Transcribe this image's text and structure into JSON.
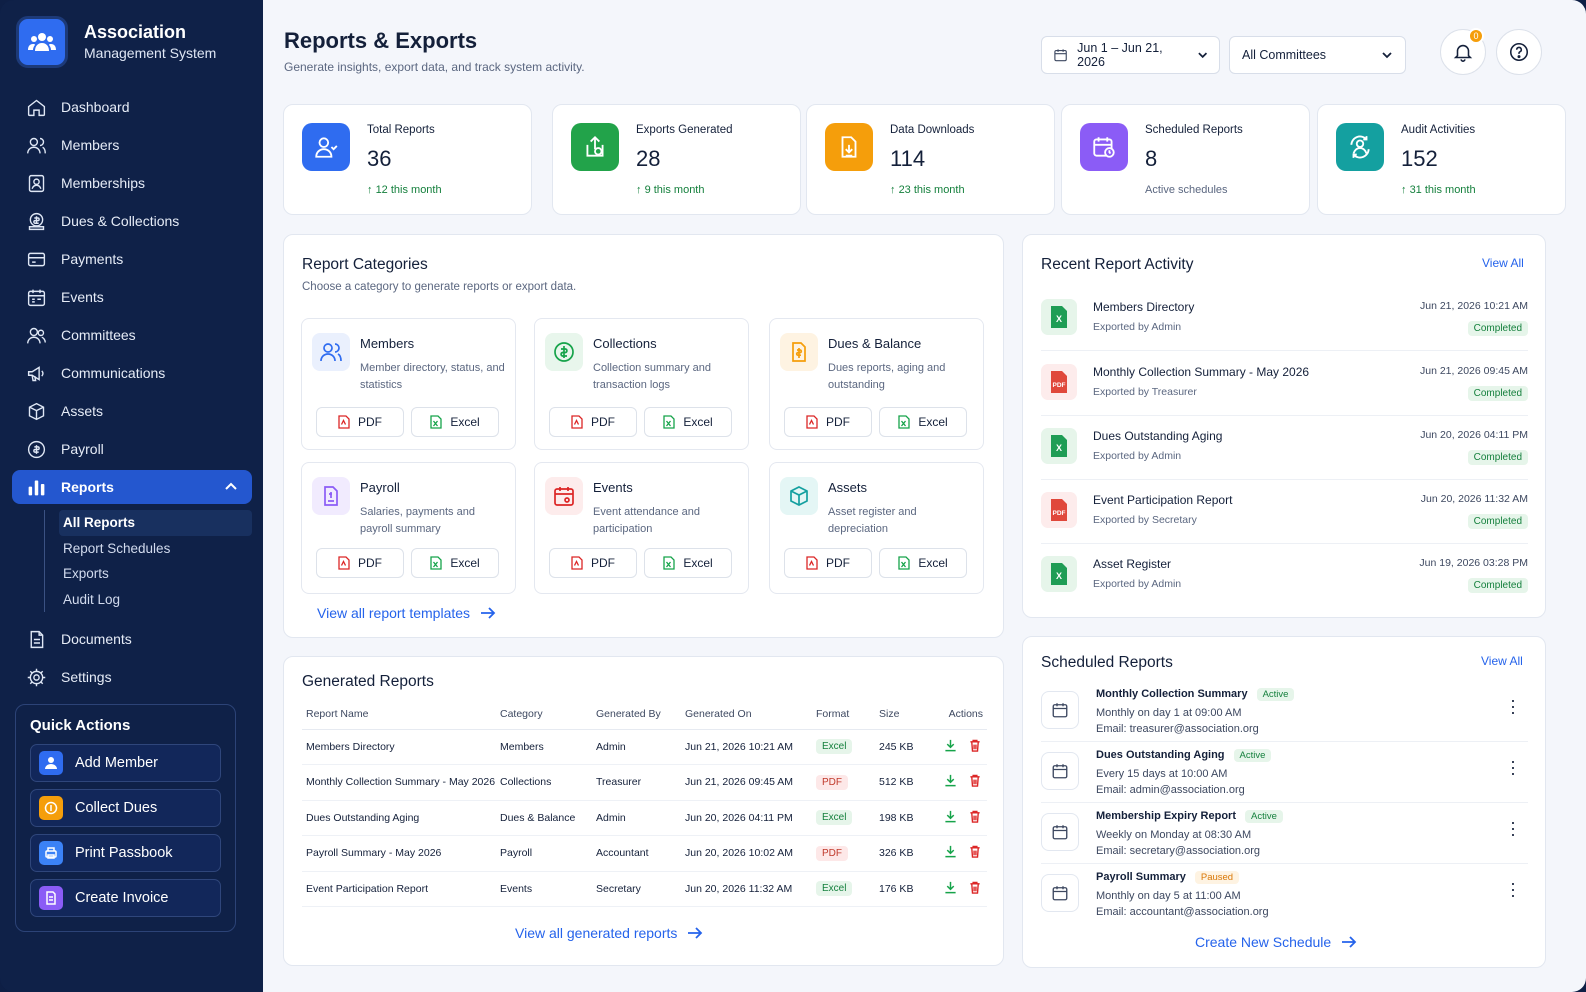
{
  "brand": {
    "title": "Association",
    "subtitle": "Management System"
  },
  "sidebar": {
    "items": [
      {
        "label": "Dashboard",
        "icon": "home-icon"
      },
      {
        "label": "Members",
        "icon": "users-icon"
      },
      {
        "label": "Memberships",
        "icon": "id-card-icon"
      },
      {
        "label": "Dues & Collections",
        "icon": "coins-icon"
      },
      {
        "label": "Payments",
        "icon": "credit-card-icon"
      },
      {
        "label": "Events",
        "icon": "calendar-icon"
      },
      {
        "label": "Committees",
        "icon": "group-icon"
      },
      {
        "label": "Communications",
        "icon": "megaphone-icon"
      },
      {
        "label": "Assets",
        "icon": "box-icon"
      },
      {
        "label": "Payroll",
        "icon": "payroll-icon"
      },
      {
        "label": "Reports",
        "icon": "bar-chart-icon"
      },
      {
        "label": "Documents",
        "icon": "document-icon"
      },
      {
        "label": "Settings",
        "icon": "gear-icon"
      }
    ],
    "reports_sub": [
      "All Reports",
      "Report Schedules",
      "Exports",
      "Audit Log"
    ],
    "active_sub": "All Reports"
  },
  "quick_actions": {
    "title": "Quick Actions",
    "items": [
      {
        "label": "Add Member",
        "icon": "user-add-icon",
        "color": "#2f6cf0"
      },
      {
        "label": "Collect Dues",
        "icon": "coin-icon",
        "color": "#f59e0b"
      },
      {
        "label": "Print Passbook",
        "icon": "print-icon",
        "color": "#3b82f6"
      },
      {
        "label": "Create Invoice",
        "icon": "invoice-icon",
        "color": "#8b5cf6"
      }
    ]
  },
  "header": {
    "title": "Reports & Exports",
    "subtitle": "Generate insights, export data, and track system activity.",
    "date_range": "Jun 1 – Jun 21, 2026",
    "committee_filter": "All Committees",
    "notification_count": "0"
  },
  "stats": [
    {
      "label": "Total Reports",
      "value": "36",
      "delta": "12 this month",
      "color": "#2f6cf0"
    },
    {
      "label": "Exports Generated",
      "value": "28",
      "delta": "9 this month",
      "color": "#22a34a"
    },
    {
      "label": "Data Downloads",
      "value": "114",
      "delta": "23 this month",
      "color": "#f59e0b"
    },
    {
      "label": "Scheduled Reports",
      "value": "8",
      "delta": "Active schedules",
      "color": "#8b5cf6"
    },
    {
      "label": "Audit Activities",
      "value": "152",
      "delta": "31 this month",
      "color": "#14a0a0"
    }
  ],
  "categories": {
    "title": "Report Categories",
    "subtitle": "Choose a category to generate reports or export data.",
    "items": [
      {
        "name": "Members",
        "desc": "Member directory, status, and statistics"
      },
      {
        "name": "Collections",
        "desc": "Collection summary and transaction logs"
      },
      {
        "name": "Dues & Balance",
        "desc": "Dues reports, aging and outstanding"
      },
      {
        "name": "Payroll",
        "desc": "Salaries, payments and payroll summary"
      },
      {
        "name": "Events",
        "desc": "Event attendance and participation"
      },
      {
        "name": "Assets",
        "desc": "Asset register and depreciation"
      }
    ],
    "pdf_label": "PDF",
    "excel_label": "Excel",
    "link": "View all report templates"
  },
  "generated": {
    "title": "Generated Reports",
    "columns": [
      "Report Name",
      "Category",
      "Generated By",
      "Generated On",
      "Format",
      "Size",
      "Actions"
    ],
    "rows": [
      {
        "name": "Members Directory",
        "category": "Members",
        "by": "Admin",
        "on": "Jun 21, 2026 10:21 AM",
        "format": "Excel",
        "size": "245 KB"
      },
      {
        "name": "Monthly Collection Summary - May 2026",
        "category": "Collections",
        "by": "Treasurer",
        "on": "Jun 21, 2026 09:45 AM",
        "format": "PDF",
        "size": "512 KB"
      },
      {
        "name": "Dues Outstanding Aging",
        "category": "Dues & Balance",
        "by": "Admin",
        "on": "Jun 20, 2026 04:11 PM",
        "format": "Excel",
        "size": "198 KB"
      },
      {
        "name": "Payroll Summary - May 2026",
        "category": "Payroll",
        "by": "Accountant",
        "on": "Jun 20, 2026 10:02 AM",
        "format": "PDF",
        "size": "326 KB"
      },
      {
        "name": "Event Participation Report",
        "category": "Events",
        "by": "Secretary",
        "on": "Jun 20, 2026 11:32 AM",
        "format": "Excel",
        "size": "176 KB"
      }
    ],
    "link": "View all generated reports"
  },
  "activity": {
    "title": "Recent Report Activity",
    "view_all": "View All",
    "items": [
      {
        "name": "Members Directory",
        "by": "Exported by Admin",
        "date": "Jun 21, 2026 10:21 AM",
        "status": "Completed",
        "type": "X"
      },
      {
        "name": "Monthly Collection Summary - May 2026",
        "by": "Exported by Treasurer",
        "date": "Jun 21, 2026 09:45 AM",
        "status": "Completed",
        "type": "PDF"
      },
      {
        "name": "Dues Outstanding Aging",
        "by": "Exported by Admin",
        "date": "Jun 20, 2026 04:11 PM",
        "status": "Completed",
        "type": "X"
      },
      {
        "name": "Event Participation Report",
        "by": "Exported by Secretary",
        "date": "Jun 20, 2026 11:32 AM",
        "status": "Completed",
        "type": "PDF"
      },
      {
        "name": "Asset Register",
        "by": "Exported by Admin",
        "date": "Jun 19, 2026 03:28 PM",
        "status": "Completed",
        "type": "X"
      }
    ]
  },
  "scheduled": {
    "title": "Scheduled Reports",
    "view_all": "View All",
    "items": [
      {
        "name": "Monthly Collection Summary",
        "status": "Active",
        "freq": "Monthly on day 1 at 09:00 AM",
        "email": "Email: treasurer@association.org"
      },
      {
        "name": "Dues Outstanding Aging",
        "status": "Active",
        "freq": "Every 15 days at 10:00 AM",
        "email": "Email: admin@association.org"
      },
      {
        "name": "Membership Expiry Report",
        "status": "Active",
        "freq": "Weekly on Monday at 08:30 AM",
        "email": "Email: secretary@association.org"
      },
      {
        "name": "Payroll Summary",
        "status": "Paused",
        "freq": "Monthly on day 5 at 11:00 AM",
        "email": "Email: accountant@association.org"
      }
    ],
    "link": "Create New Schedule"
  }
}
